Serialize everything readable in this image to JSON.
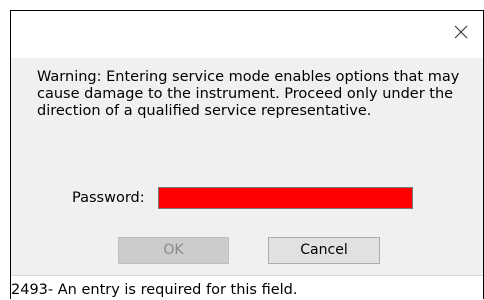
{
  "dialog": {
    "close_icon": "close-icon",
    "warning_text": "Warning: Entering service mode enables options that may cause damage to the instrument. Proceed only under the direction of a qualified service representative.",
    "password_label": "Password:",
    "password_value": "",
    "password_field_color": "#ff0000",
    "ok_label": "OK",
    "ok_enabled": false,
    "cancel_label": "Cancel"
  },
  "status": {
    "message": "2493-  An entry is required for this field."
  }
}
